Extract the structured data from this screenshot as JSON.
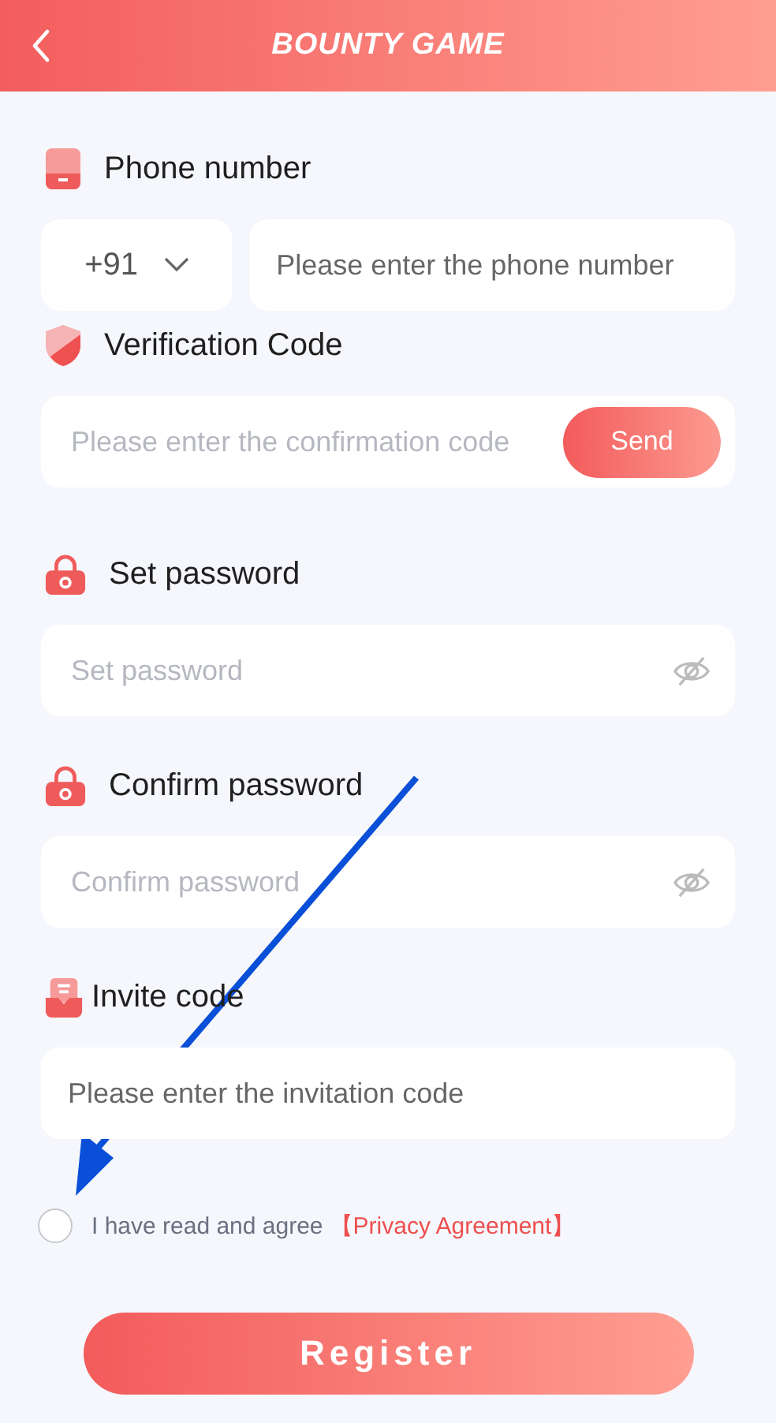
{
  "header": {
    "title": "BOUNTY GAME"
  },
  "fields": [
    {
      "kind": "phone",
      "label": "Phone number",
      "country_code": "+91",
      "placeholder": "Please enter the phone number"
    },
    {
      "kind": "code",
      "label": "Verification Code",
      "placeholder": "Please enter the confirmation code",
      "button": "Send"
    },
    {
      "kind": "password",
      "label": "Set password",
      "placeholder": "Set password"
    },
    {
      "kind": "password",
      "label": "Confirm password",
      "placeholder": "Confirm password"
    },
    {
      "kind": "invite",
      "label": "Invite code",
      "placeholder": "Please enter the invitation code"
    }
  ],
  "agreement": {
    "checked": false,
    "text": "I have read and agree",
    "link": "【Privacy Agreement】"
  },
  "register_button": "Register"
}
